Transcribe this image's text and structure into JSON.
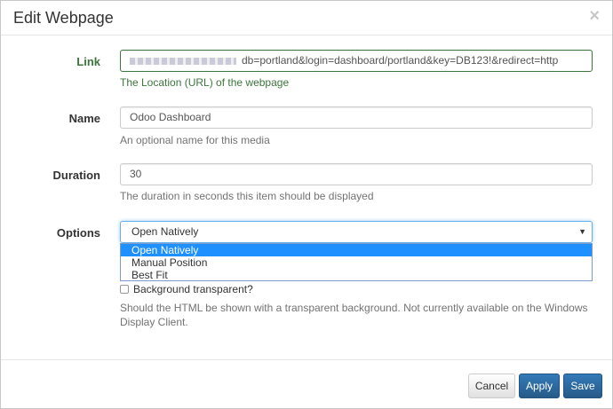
{
  "dialog": {
    "title": "Edit Webpage",
    "close_symbol": "×"
  },
  "fields": {
    "link": {
      "label": "Link",
      "value": "db=portland&login=dashboard/portland&key=DB123!&redirect=http",
      "help": "The Location (URL) of the webpage"
    },
    "name": {
      "label": "Name",
      "value": "Odoo Dashboard",
      "help": "An optional name for this media"
    },
    "duration": {
      "label": "Duration",
      "value": "30",
      "help": "The duration in seconds this item should be displayed"
    },
    "options": {
      "label": "Options",
      "selected": "Open Natively",
      "caret": "▼",
      "items": [
        "Open Natively",
        "Manual Position",
        "Best Fit"
      ]
    },
    "transparent": {
      "label": "Background transparent?",
      "checked": false,
      "help": "Should the HTML be shown with a transparent background. Not currently available on the Windows Display Client."
    }
  },
  "footer": {
    "cancel_label": "Cancel",
    "apply_label": "Apply",
    "save_label": "Save"
  },
  "colors": {
    "success": "#3c763d",
    "primary": "#337ab7",
    "option_highlight": "#1e90ff"
  }
}
